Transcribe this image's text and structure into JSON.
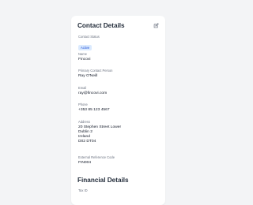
{
  "contact_details": {
    "title": "Contact Details",
    "status": {
      "label": "Contact Status",
      "value": "Active"
    },
    "name": {
      "label": "Name",
      "value": "Fincovi"
    },
    "primary_contact": {
      "label": "Primary Contact Person",
      "value": "Ray O'Neill"
    },
    "email": {
      "label": "Email",
      "value": "ray@fincovi.com"
    },
    "phone": {
      "label": "Phone",
      "value": "+353 85 123 4567"
    },
    "address": {
      "label": "Address",
      "lines": [
        "20 Stephen Street Lower",
        "Dublin 2",
        "Ireland",
        "D02 DT04"
      ]
    },
    "external_reference": {
      "label": "External Reference Code",
      "value": "FIN004"
    }
  },
  "financial_details": {
    "title": "Financial Details",
    "tax_id": {
      "label": "Tax ID"
    }
  },
  "icons": {
    "edit": "edit-icon"
  },
  "colors": {
    "background": "#f3f4f6",
    "card": "#ffffff",
    "badge_bg": "#dbeafe",
    "badge_text": "#1d4ed8",
    "label": "#6b7280"
  }
}
